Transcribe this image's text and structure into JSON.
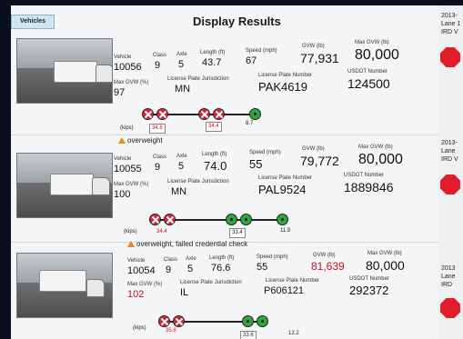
{
  "tab_label": "Vehicles",
  "title": "Display Results",
  "labels": {
    "vehicle": "Vehicle",
    "class": "Class",
    "axle": "Axle",
    "length": "Length (ft)",
    "speed": "Speed (mph)",
    "gvw": "GVW (lb)",
    "max_gvw": "Max GVW (lb)",
    "max_gvw_pct": "Max GVW (%)",
    "jurisdiction": "License Plate Jurisdiction",
    "plate": "License Plate Number",
    "usdot": "USDOT Number",
    "kips": "(kips)"
  },
  "records": [
    {
      "vehicle": "10056",
      "class": "9",
      "axle": "5",
      "length": "43.7",
      "speed": "67",
      "gvw": "77,931",
      "gvw_over": false,
      "max_gvw": "80,000",
      "max_gvw_pct": "97",
      "max_pct_over": false,
      "jurisdiction": "MN",
      "plate": "PAK4619",
      "usdot": "124500",
      "warning": "",
      "spacings": [
        {
          "v": "34.8",
          "over": true
        },
        {
          "v": "34.4",
          "over": true
        },
        {
          "v": "8.7",
          "over": false
        }
      ],
      "side": [
        "2013-",
        "Lane 1",
        "IRD V"
      ]
    },
    {
      "vehicle": "10055",
      "class": "9",
      "axle": "5",
      "length": "74.0",
      "speed": "55",
      "gvw": "79,772",
      "gvw_over": false,
      "max_gvw": "80,000",
      "max_gvw_pct": "100",
      "max_pct_over": false,
      "jurisdiction": "MN",
      "plate": "PAL9524",
      "usdot": "1889846",
      "warning": "overweight",
      "spacings": [
        {
          "v": "34.4",
          "over": true
        },
        {
          "v": "33.4",
          "over": false
        },
        {
          "v": "11.9",
          "over": false
        }
      ],
      "side": [
        "2013-",
        "Lane",
        "IRD V"
      ]
    },
    {
      "vehicle": "10054",
      "class": "9",
      "axle": "5",
      "length": "76.6",
      "speed": "55",
      "gvw": "81,639",
      "gvw_over": true,
      "max_gvw": "80,000",
      "max_gvw_pct": "102",
      "max_pct_over": true,
      "jurisdiction": "IL",
      "plate": "P606121",
      "usdot": "292372",
      "warning": "overweight, failed credential check",
      "spacings": [
        {
          "v": "35.8",
          "over": true
        },
        {
          "v": "33.6",
          "over": false
        },
        {
          "v": "12.2",
          "over": false
        }
      ],
      "side": [
        "2013",
        "Lane",
        "IRD"
      ]
    }
  ]
}
